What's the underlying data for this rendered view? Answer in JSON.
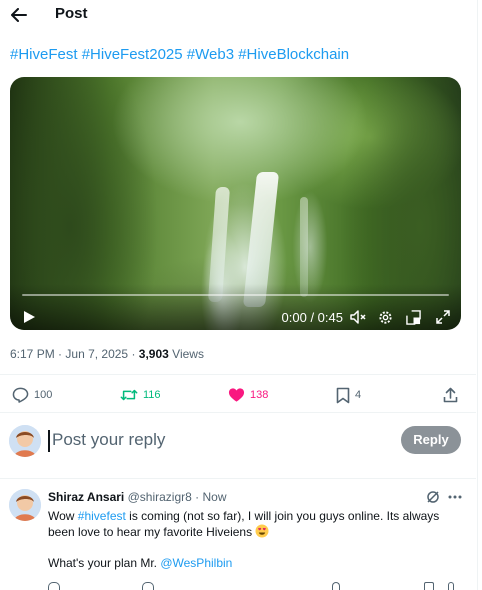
{
  "header": {
    "title": "Post",
    "back_icon": "arrow-left-icon"
  },
  "post": {
    "hashtags": [
      "#HiveFest",
      "#HiveFest2025",
      "#Web3",
      "#HiveBlockchain"
    ],
    "video": {
      "current_time": "0:00",
      "duration": "0:45",
      "timecode": "0:00 / 0:45",
      "progress": 0
    },
    "meta": {
      "time": "6:17 PM",
      "date": "Jun 7, 2025",
      "views_count": "3,903",
      "views_label": "Views"
    },
    "actions": {
      "replies": "100",
      "reposts": "116",
      "likes": "138",
      "bookmarks": "4"
    }
  },
  "compose": {
    "placeholder": "Post your reply",
    "reply_button": "Reply"
  },
  "comment": {
    "name": "Shiraz Ansari",
    "handle": "@shirazigr8",
    "time": "Now",
    "text_prefix": "Wow ",
    "mention_tag": "#hivefest",
    "text_suffix": " is coming (not so far), I will join you guys online. Its always been love to hear my favorite Hiveiens",
    "line2_prefix": "What's your plan Mr. ",
    "line2_mention": "@WesPhilbin"
  },
  "colors": {
    "accent": "#1d9bf0",
    "repost": "#00ba7c",
    "like": "#f91880",
    "text": "#0f1419",
    "muted": "#536471",
    "reply_button": "#8b9298"
  }
}
